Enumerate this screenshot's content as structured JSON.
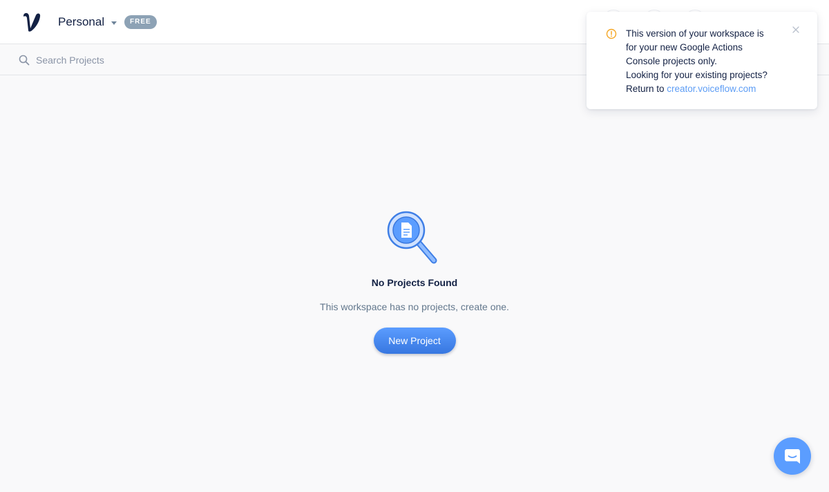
{
  "header": {
    "workspace_name": "Personal",
    "plan_badge": "FREE",
    "logo": "voiceflow-v-logo"
  },
  "search": {
    "placeholder": "Search Projects",
    "value": ""
  },
  "empty_state": {
    "title": "No Projects Found",
    "description": "This workspace has no projects, create one.",
    "button_label": "New Project",
    "icon": "magnifier-document-icon"
  },
  "toast": {
    "icon": "warning-icon",
    "line1": "This version of your workspace is",
    "line2": "for your new Google Actions",
    "line3": "Console projects only.",
    "line4": "Looking for your existing projects?",
    "line5_prefix": "Return to ",
    "link_text": "creator.voiceflow.com",
    "close_icon": "close-icon"
  },
  "chat_launcher": {
    "icon": "chat-icon"
  },
  "colors": {
    "accent": "#5b9dff",
    "warning": "#f5a623",
    "link": "#5d9df5",
    "badge": "#8da2b5",
    "background": "#f9f9fa"
  }
}
